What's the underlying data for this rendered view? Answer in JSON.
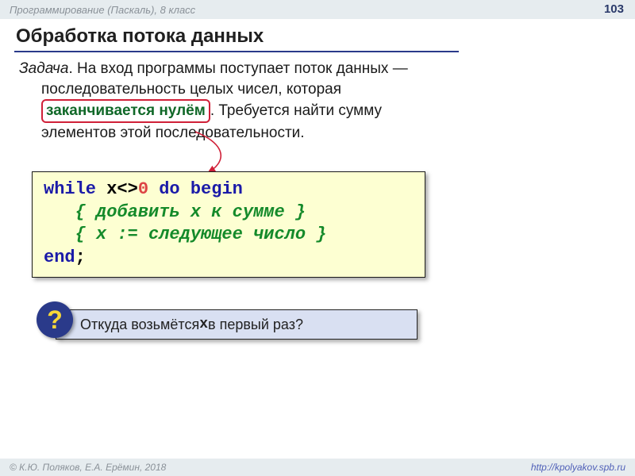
{
  "header": {
    "course": "Программирование (Паскаль), 8 класс",
    "page_number": "103"
  },
  "title": "Обработка потока данных",
  "task": {
    "label": "Задача",
    "line1a": ". На вход программы поступает поток данных —",
    "line2": "последовательность целых чисел, которая",
    "highlight": "заканчивается нулём",
    "line3a": ". Требуется найти сумму",
    "line4": "элементов этой последовательности."
  },
  "code": {
    "l1_kw1": "while",
    "l1_mid": " x<>",
    "l1_num": "0",
    "l1_kw2": " do begin",
    "l2": "   { добавить x к сумме }",
    "l3": "   { x := следующее число }",
    "l4_kw": "end",
    "l4_tail": ";"
  },
  "question": {
    "mark": "?",
    "text_a": " Откуда возьмётся ",
    "text_x": "x",
    "text_b": "  в первый раз?"
  },
  "footer": {
    "left": "© К.Ю. Поляков, Е.А. Ерёмин, 2018",
    "right": "http://kpolyakov.spb.ru"
  }
}
